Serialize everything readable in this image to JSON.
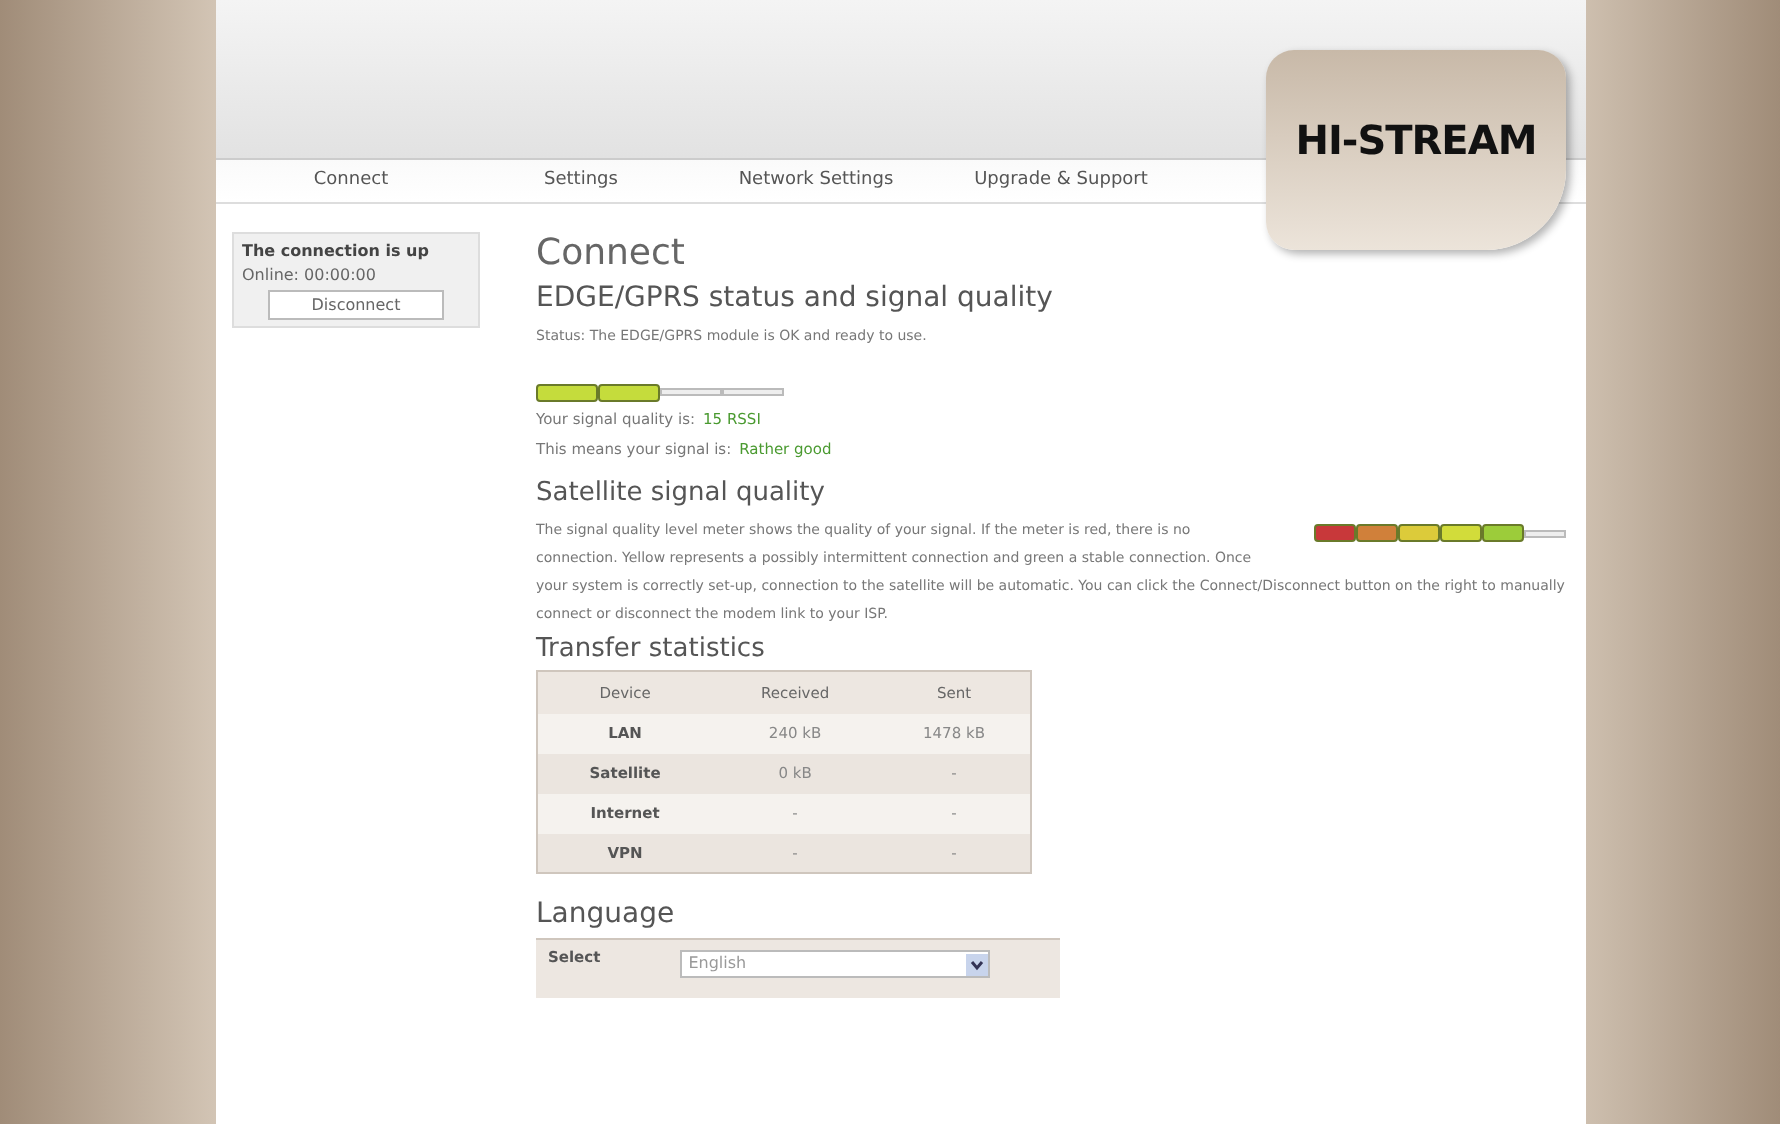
{
  "logo": "HI-STREAM",
  "nav": [
    {
      "label": "Connect"
    },
    {
      "label": "Settings"
    },
    {
      "label": "Network Settings"
    },
    {
      "label": "Upgrade & Support"
    }
  ],
  "sidebar": {
    "status": "The connection is up",
    "online": "Online: 00:00:00",
    "button": "Disconnect"
  },
  "page_title": "Connect",
  "edge": {
    "heading": "EDGE/GPRS status and signal quality",
    "status": "Status: The EDGE/GPRS module is OK and ready to use.",
    "level": 0.5,
    "quality_label": "Your signal quality is:",
    "quality_value": "15 RSSI",
    "means_label": "This means your signal is:",
    "means_value": "Rather good"
  },
  "satellite": {
    "heading": "Satellite signal quality",
    "level": 0.83,
    "text": "The signal quality level meter shows the quality of your signal. If the meter is red, there is no connection. Yellow represents a possibly intermittent connection and green a stable connection. Once your system is correctly set-up, connection to the satellite will be automatic. You can click the Connect/Disconnect button on the right to manually connect or disconnect the modem link to your ISP."
  },
  "transfer": {
    "heading": "Transfer statistics",
    "columns": [
      "Device",
      "Received",
      "Sent"
    ],
    "rows": [
      [
        "LAN",
        "240 kB",
        "1478 kB"
      ],
      [
        "Satellite",
        "0 kB",
        "-"
      ],
      [
        "Internet",
        "-",
        "-"
      ],
      [
        "VPN",
        "-",
        "-"
      ]
    ]
  },
  "language": {
    "heading": "Language",
    "label": "Select",
    "value": "English"
  }
}
